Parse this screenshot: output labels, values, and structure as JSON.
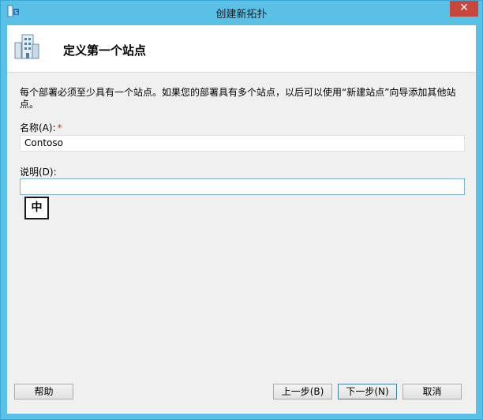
{
  "window": {
    "title": "创建新拓扑",
    "close_symbol": "✕",
    "title_bar_color": "#5bc0e6",
    "app_icon": "topology-builder-icon"
  },
  "header": {
    "icon": "building-icon",
    "title": "定义第一个站点"
  },
  "form": {
    "description": "每个部署必须至少具有一个站点。如果您的部署具有多个站点，以后可以使用“新建站点”向导添加其他站点。",
    "name_label": "名称(A):",
    "required_marker": "*",
    "name_value": "Contoso",
    "desc_label": "说明(D):",
    "desc_value": ""
  },
  "ime": {
    "indicator": "中"
  },
  "buttons": {
    "help": "帮助",
    "back": "上一步(B)",
    "next": "下一步(N)",
    "cancel": "取消"
  }
}
